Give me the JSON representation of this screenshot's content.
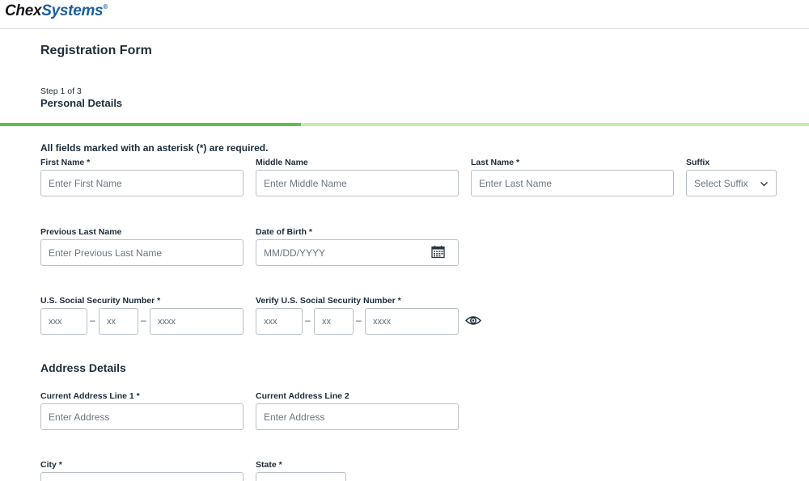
{
  "header": {
    "logo_chex": "Chex",
    "logo_systems": "Systems",
    "logo_reg": "®"
  },
  "page": {
    "title": "Registration Form",
    "step_label": "Step 1 of 3",
    "step_title": "Personal Details",
    "progress_fraction": 0.372
  },
  "form": {
    "required_note": "All fields marked with an asterisk (*) are required.",
    "first_name": {
      "label": "First Name *",
      "placeholder": "Enter First Name",
      "value": ""
    },
    "middle_name": {
      "label": "Middle Name",
      "placeholder": "Enter Middle Name",
      "value": ""
    },
    "last_name": {
      "label": "Last Name *",
      "placeholder": "Enter Last Name",
      "value": ""
    },
    "suffix": {
      "label": "Suffix",
      "selected": "Select Suffix"
    },
    "previous_last_name": {
      "label": "Previous Last Name",
      "placeholder": "Enter Previous Last Name",
      "value": ""
    },
    "dob": {
      "label": "Date of Birth *",
      "placeholder": "MM/DD/YYYY",
      "value": ""
    },
    "ssn": {
      "label": "U.S. Social Security Number *",
      "part1_placeholder": "xxx",
      "part2_placeholder": "xx",
      "part3_placeholder": "xxxx",
      "separator": "–"
    },
    "verify_ssn": {
      "label": "Verify U.S. Social Security Number *",
      "part1_placeholder": "xxx",
      "part2_placeholder": "xx",
      "part3_placeholder": "xxxx",
      "separator": "–"
    }
  },
  "address": {
    "section_title": "Address Details",
    "line1": {
      "label": "Current Address Line 1 *",
      "placeholder": "Enter Address",
      "value": ""
    },
    "line2": {
      "label": "Current Address Line 2",
      "placeholder": "Enter Address",
      "value": ""
    },
    "city": {
      "label": "City *"
    },
    "state": {
      "label": "State *"
    }
  },
  "icons": {
    "calendar": "calendar-icon",
    "eye": "eye-icon",
    "chevron": "chevron-down-icon"
  },
  "colors": {
    "progress_fill": "#5cc142",
    "progress_track": "#c2ebb2",
    "logo_blue": "#1b5fa0"
  }
}
